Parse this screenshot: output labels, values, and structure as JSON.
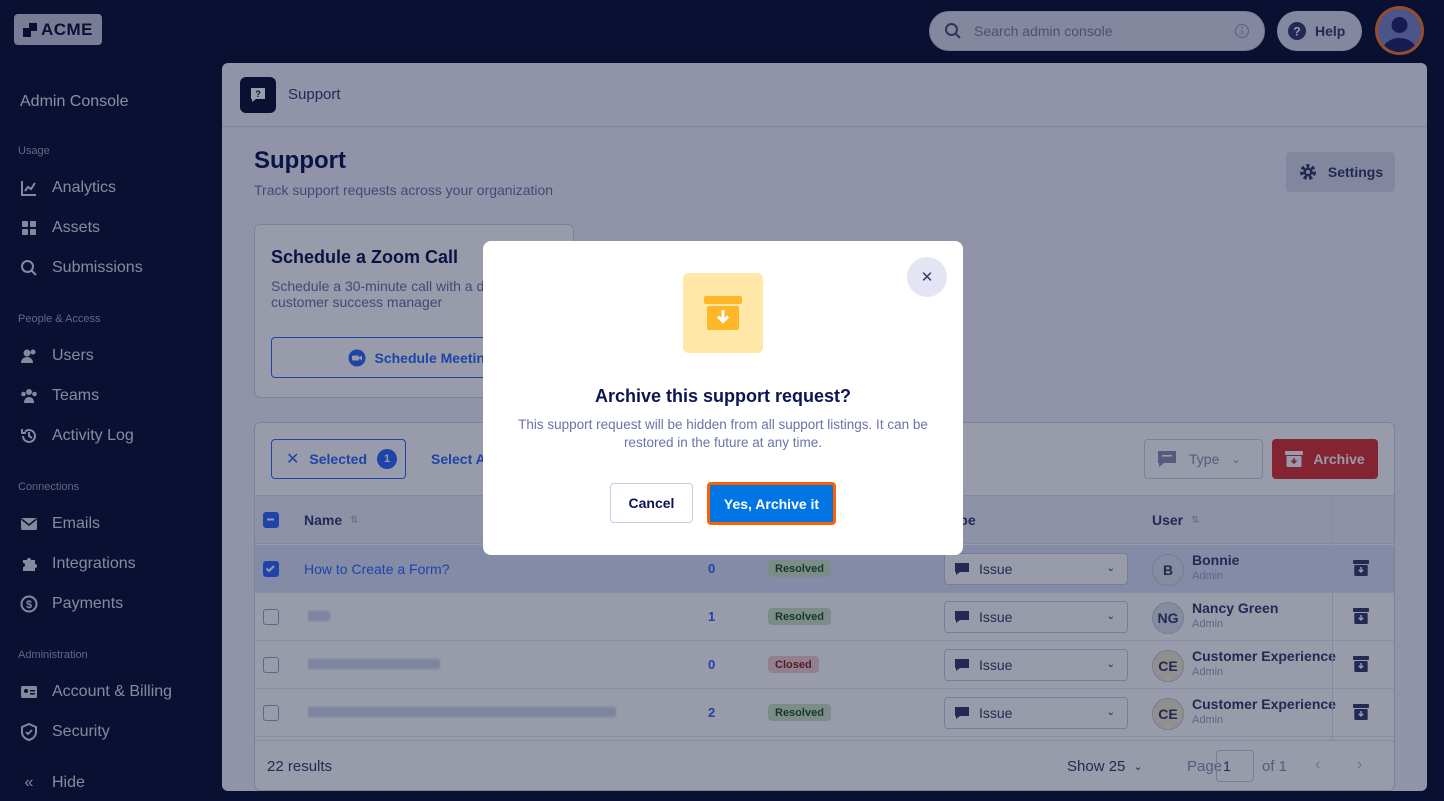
{
  "brand": {
    "logo_text": "ACME"
  },
  "topbar": {
    "search_placeholder": "Search admin console",
    "help_label": "Help"
  },
  "sidebar": {
    "title": "Admin Console",
    "sections": [
      {
        "label": "Usage",
        "items": [
          {
            "label": "Analytics",
            "icon": "analytics-icon"
          },
          {
            "label": "Assets",
            "icon": "assets-icon"
          },
          {
            "label": "Submissions",
            "icon": "search-icon"
          }
        ]
      },
      {
        "label": "People & Access",
        "items": [
          {
            "label": "Users",
            "icon": "users-icon"
          },
          {
            "label": "Teams",
            "icon": "teams-icon"
          },
          {
            "label": "Activity Log",
            "icon": "activity-log-icon"
          }
        ]
      },
      {
        "label": "Connections",
        "items": [
          {
            "label": "Emails",
            "icon": "email-icon"
          },
          {
            "label": "Integrations",
            "icon": "puzzle-icon"
          },
          {
            "label": "Payments",
            "icon": "payments-icon"
          }
        ]
      },
      {
        "label": "Administration",
        "items": [
          {
            "label": "Account & Billing",
            "icon": "billing-icon"
          },
          {
            "label": "Security",
            "icon": "shield-icon"
          }
        ]
      }
    ],
    "hide_label": "Hide"
  },
  "breadcrumb": {
    "label": "Support"
  },
  "page": {
    "title": "Support",
    "subtitle": "Track support requests across your organization",
    "settings_label": "Settings"
  },
  "zoom_card": {
    "title": "Schedule a Zoom Call",
    "description": "Schedule a 30-minute call with a dedicated customer success manager",
    "button_label": "Schedule Meeting"
  },
  "table": {
    "toolbar": {
      "selected_label": "Selected",
      "selected_count": "1",
      "select_all_label": "Select All",
      "type_filter_label": "Type",
      "archive_label": "Archive"
    },
    "columns": {
      "name": "Name",
      "type": "Type",
      "user": "User"
    },
    "rows": [
      {
        "name": "How to Create a Form?",
        "count": "0",
        "status": "Resolved",
        "type": "Issue",
        "user_initials": "B",
        "user_name": "Bonnie",
        "user_role": "Admin",
        "selected": true
      },
      {
        "name": "",
        "count": "1",
        "status": "Resolved",
        "type": "Issue",
        "user_initials": "NG",
        "user_name": "Nancy Green",
        "user_role": "Admin",
        "selected": false
      },
      {
        "name": "",
        "count": "0",
        "status": "Closed",
        "type": "Issue",
        "user_initials": "CE",
        "user_name": "Customer Experience",
        "user_role": "Admin",
        "selected": false
      },
      {
        "name": "",
        "count": "2",
        "status": "Resolved",
        "type": "Issue",
        "user_initials": "CE",
        "user_name": "Customer Experience",
        "user_role": "Admin",
        "selected": false
      }
    ],
    "footer": {
      "results": "22 results",
      "show_label": "Show 25",
      "page_label": "Page",
      "page_value": "1",
      "of_label": "of 1"
    }
  },
  "modal": {
    "title": "Archive this support request?",
    "description": "This support request will be hidden from all support listings. It can be restored in the future at any time.",
    "cancel_label": "Cancel",
    "confirm_label": "Yes, Archive it",
    "icon": "archive-box-icon"
  },
  "colors": {
    "background": "#0a1033",
    "accent": "#2e69ff",
    "primary_button": "#0075e3",
    "highlight_outline": "#ff6100",
    "danger": "#dc3333"
  }
}
